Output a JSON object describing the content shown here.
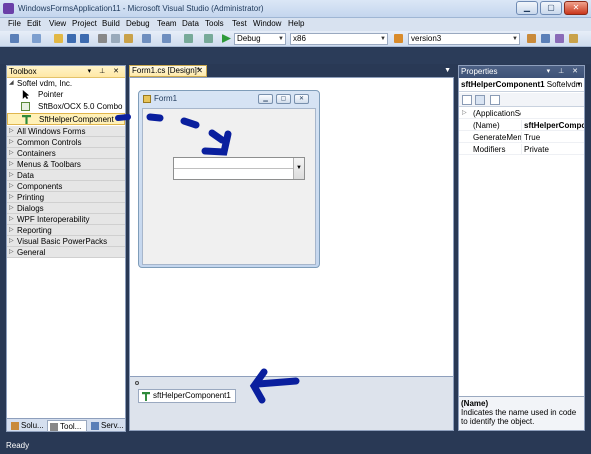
{
  "window": {
    "title": "WindowsFormsApplication11 - Microsoft Visual Studio (Administrator)"
  },
  "menu": [
    "File",
    "Edit",
    "View",
    "Project",
    "Build",
    "Debug",
    "Team",
    "Data",
    "Tools",
    "Test",
    "Window",
    "Help"
  ],
  "toolbar": {
    "configuration": "Debug",
    "platform": "x86",
    "find_value": "version3"
  },
  "toolbox": {
    "title": "Toolbox",
    "group_open": "Softel vdm, Inc.",
    "items": [
      {
        "label": "Pointer",
        "icon": "pointer-icon"
      },
      {
        "label": "SftBox/OCX 5.0 Combo ...",
        "icon": "combobox-icon"
      },
      {
        "label": "SftHelperComponent",
        "icon": "helper-component-icon"
      }
    ],
    "categories": [
      "All Windows Forms",
      "Common Controls",
      "Containers",
      "Menus & Toolbars",
      "Data",
      "Components",
      "Printing",
      "Dialogs",
      "WPF Interoperability",
      "Reporting",
      "Visual Basic PowerPacks",
      "General"
    ],
    "bottom_tabs": [
      "Solu...",
      "Tool...",
      "Serv..."
    ]
  },
  "document": {
    "tab_label": "Form1.cs [Design]*",
    "form_title": "Form1",
    "tray_component": "sftHelperComponent1"
  },
  "properties": {
    "title": "Properties",
    "object_name": "sftHelperComponent1",
    "object_type": "Softelvdm",
    "rows": [
      {
        "name": "(ApplicationSe",
        "value": "",
        "expand": "▷"
      },
      {
        "name": "(Name)",
        "value": "sftHelperCompone",
        "bold": true
      },
      {
        "name": "GenerateMem",
        "value": "True"
      },
      {
        "name": "Modifiers",
        "value": "Private"
      }
    ],
    "description_title": "(Name)",
    "description_text": "Indicates the name used in code to identify the object."
  },
  "status": {
    "text": "Ready"
  },
  "colors": {
    "annotation_arrow": "#0a1f9e",
    "selection": "#fff1b8"
  }
}
